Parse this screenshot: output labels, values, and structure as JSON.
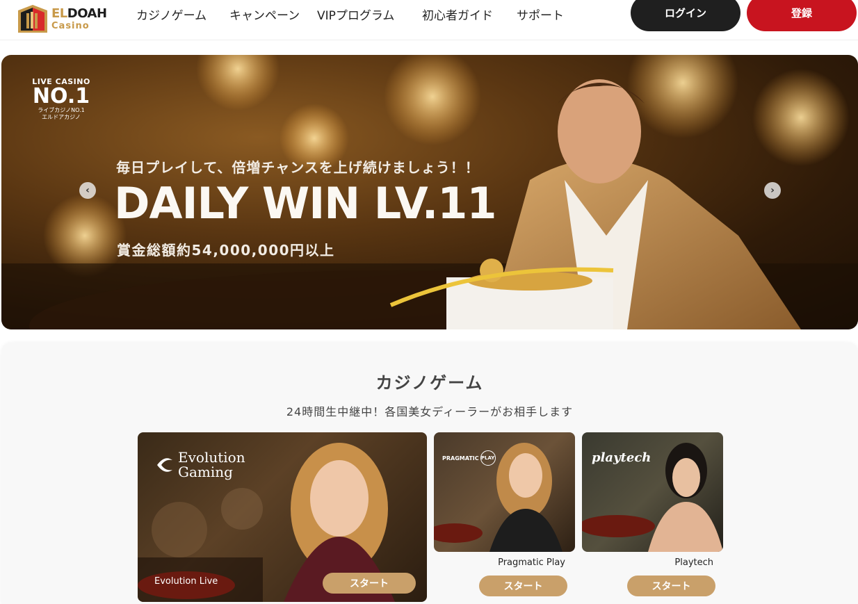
{
  "header": {
    "logo_main_accent": "EL",
    "logo_main_rest": "DOAH",
    "logo_sub": "Casino",
    "nav": [
      {
        "label": "カジノゲーム"
      },
      {
        "label": "キャンペーン"
      },
      {
        "label": "VIPプログラム"
      },
      {
        "label": "初心者ガイド"
      },
      {
        "label": "サポート"
      }
    ],
    "login_label": "ログイン",
    "register_label": "登録"
  },
  "hero": {
    "badge_top": "LIVE CASINO",
    "badge_num": "NO.1",
    "badge_sub1": "ライブカジノNO.1",
    "badge_sub2": "エルドアカジノ",
    "subtitle": "毎日プレイして、倍増チャンスを上げ続けましょう！！",
    "title": "DAILY WIN LV.11",
    "prize": "賞金総額約54,000,000円以上"
  },
  "games": {
    "title": "カジノゲーム",
    "subtitle": "24時間生中継中！各国美女ディーラーがお相手します",
    "cards": [
      {
        "provider_logo_line1": "Evolution",
        "provider_logo_line2": "Gaming",
        "caption": "Evolution Live",
        "start_label": "スタート"
      },
      {
        "provider_logo": "PRAGMATIC",
        "provider_logo_badge": "PLAY",
        "caption": "Pragmatic Play",
        "start_label": "スタート"
      },
      {
        "provider_logo": "playtech",
        "caption": "Playtech",
        "start_label": "スタート"
      }
    ]
  },
  "colors": {
    "accent_gold": "#c9a06a",
    "register_red": "#c8141f",
    "login_dark": "#1f1f1f"
  }
}
